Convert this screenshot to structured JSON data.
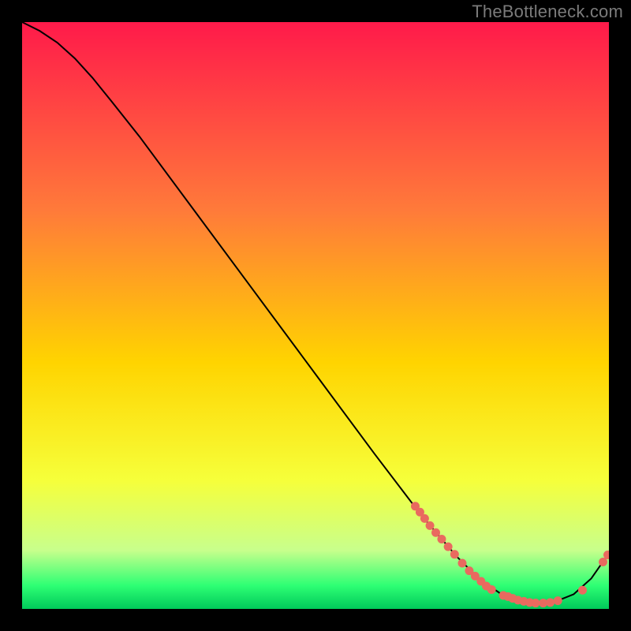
{
  "watermark": "TheBottleneck.com",
  "colors": {
    "background": "#000000",
    "curve": "#000000",
    "dot": "#e96a5f",
    "grad_top": "#ff1a4a",
    "grad_mid_upper": "#ff7a3a",
    "grad_mid": "#ffd400",
    "grad_lower": "#f6ff3a",
    "grad_green_pale": "#c8ff8c",
    "grad_green": "#2eff74",
    "grad_green_deep": "#00c95a"
  },
  "chart_data": {
    "type": "line",
    "title": "",
    "xlabel": "",
    "ylabel": "",
    "xlim": [
      0,
      100
    ],
    "ylim": [
      0,
      100
    ],
    "curve": [
      {
        "x": 0,
        "y": 100.0
      },
      {
        "x": 3,
        "y": 98.5
      },
      {
        "x": 6,
        "y": 96.5
      },
      {
        "x": 9,
        "y": 93.8
      },
      {
        "x": 12,
        "y": 90.5
      },
      {
        "x": 15,
        "y": 86.8
      },
      {
        "x": 20,
        "y": 80.5
      },
      {
        "x": 30,
        "y": 67.0
      },
      {
        "x": 40,
        "y": 53.5
      },
      {
        "x": 50,
        "y": 40.0
      },
      {
        "x": 60,
        "y": 26.5
      },
      {
        "x": 68,
        "y": 16.0
      },
      {
        "x": 74,
        "y": 9.0
      },
      {
        "x": 78,
        "y": 5.0
      },
      {
        "x": 82,
        "y": 2.3
      },
      {
        "x": 85,
        "y": 1.2
      },
      {
        "x": 88,
        "y": 1.0
      },
      {
        "x": 91,
        "y": 1.3
      },
      {
        "x": 94,
        "y": 2.5
      },
      {
        "x": 97,
        "y": 5.2
      },
      {
        "x": 100,
        "y": 9.5
      }
    ],
    "dots": [
      {
        "x": 67.0,
        "y": 17.5
      },
      {
        "x": 67.8,
        "y": 16.5
      },
      {
        "x": 68.6,
        "y": 15.4
      },
      {
        "x": 69.5,
        "y": 14.2
      },
      {
        "x": 70.5,
        "y": 13.0
      },
      {
        "x": 71.5,
        "y": 11.9
      },
      {
        "x": 72.6,
        "y": 10.6
      },
      {
        "x": 73.7,
        "y": 9.3
      },
      {
        "x": 75.0,
        "y": 7.8
      },
      {
        "x": 76.2,
        "y": 6.5
      },
      {
        "x": 77.2,
        "y": 5.6
      },
      {
        "x": 78.2,
        "y": 4.7
      },
      {
        "x": 79.1,
        "y": 3.9
      },
      {
        "x": 80.0,
        "y": 3.3
      },
      {
        "x": 82.0,
        "y": 2.3
      },
      {
        "x": 82.8,
        "y": 2.1
      },
      {
        "x": 83.6,
        "y": 1.8
      },
      {
        "x": 84.5,
        "y": 1.5
      },
      {
        "x": 85.5,
        "y": 1.3
      },
      {
        "x": 86.5,
        "y": 1.1
      },
      {
        "x": 87.5,
        "y": 1.0
      },
      {
        "x": 88.8,
        "y": 1.0
      },
      {
        "x": 90.0,
        "y": 1.1
      },
      {
        "x": 91.3,
        "y": 1.4
      },
      {
        "x": 95.5,
        "y": 3.2
      },
      {
        "x": 99.0,
        "y": 8.0
      },
      {
        "x": 99.8,
        "y": 9.2
      }
    ]
  }
}
